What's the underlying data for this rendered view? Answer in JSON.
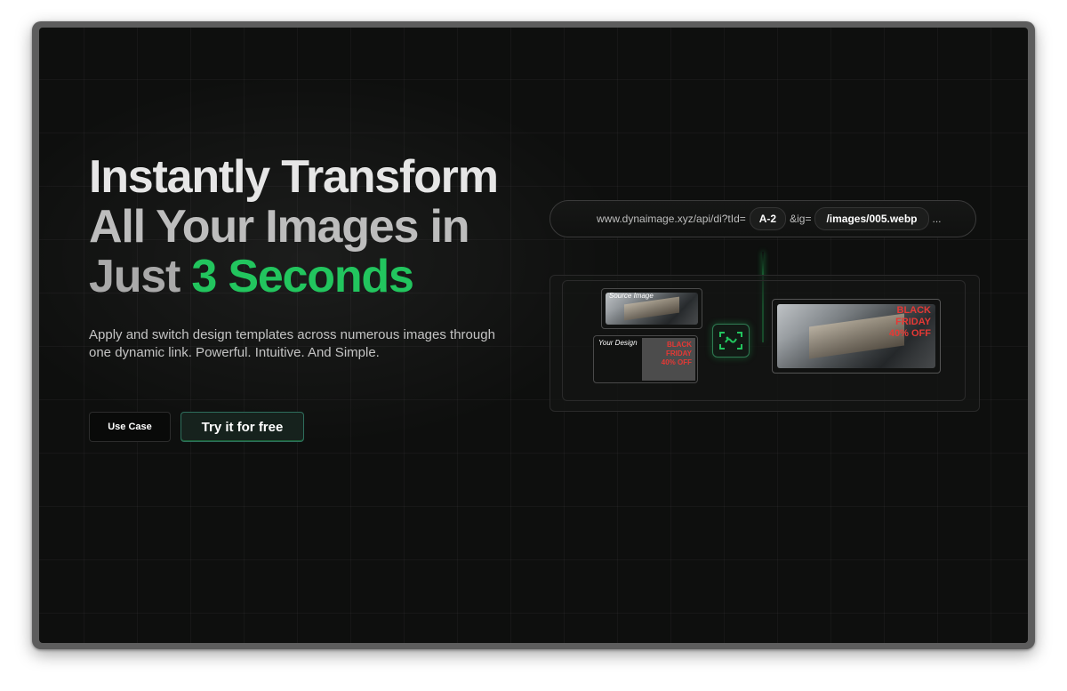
{
  "hero": {
    "headline_line1": "Instantly Transform",
    "headline_line2": "All Your Images in",
    "headline_line3_prefix": "Just",
    "headline_line3_accent": "3 Seconds",
    "subtitle": "Apply and switch design templates across numerous images through one dynamic link. Powerful. Intuitive. And Simple."
  },
  "buttons": {
    "use_case": "Use Case",
    "try_free": "Try it for free"
  },
  "url_builder": {
    "base": "www.dynaimage.xyz/api/di?tId=",
    "template_id": "A-2",
    "image_param": "&ig=",
    "image_path": "/images/005.webp",
    "ellipsis": "..."
  },
  "preview": {
    "source_label": "Source Image",
    "design_label": "Your Design",
    "promo_line1": "BLACK",
    "promo_line2": "FRIDAY",
    "promo_line3": "40% OFF"
  },
  "icons": {
    "transform": "scan-transform-icon"
  },
  "colors": {
    "accent": "#22c55e",
    "background": "#0e0f0e",
    "promo_red": "#e53935"
  }
}
